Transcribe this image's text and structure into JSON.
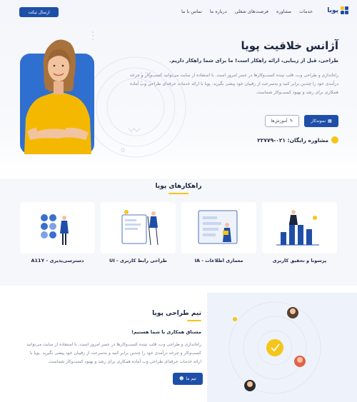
{
  "header": {
    "logo_text": "پویا",
    "nav": [
      "خدمات",
      "مشاوره",
      "فرصت‌های شغلی",
      "درباره ما",
      "تماس با ما"
    ],
    "ticket_label": "ارسال تیکت"
  },
  "hero": {
    "title": "آژانس خلاقیت پویا",
    "subtitle": "طراحی، قبل از زیبایی، ارائه راهکار است! ما برای شما راهکار داریم.",
    "description": "راه‌اندازی و طراحی وب، قلب تپنده کسب‌وکارها در عصر امروز است. با استفاده از سایت می‌توانید کسب‌وکار و چرخه درآمدی خود را چندین برابر کنید و به‌سرعت از رقیبان خود پیشی بگیرید. پویا با ارائه خدمات حرفه‌ای طراحی وب آماده همکاری برای رشد و بهبود کسب‌وکار شماست.",
    "sample_label": "نمونه‌کار",
    "learning_label": "آموزش‌ها",
    "consult_label": "مشاوره رایگان: ۰۲۱-۲۲۷۷۹"
  },
  "solutions": {
    "title": "راهکارهای پویا",
    "items": [
      {
        "label": "پرسونا و تحقیق کاربری",
        "icon": "persona-research-illustration"
      },
      {
        "label": "معماری اطلاعات - IA",
        "icon": "information-architecture-illustration"
      },
      {
        "label": "طراحی رابط کاربری - UI",
        "icon": "ui-design-illustration"
      },
      {
        "label": "دسترسی‌پذیری - A11Y",
        "icon": "accessibility-illustration"
      }
    ]
  },
  "team": {
    "title": "تیم طراحی پویا",
    "subtitle": "مشتاق همکاری با شما هستیم!",
    "description": "راه‌اندازی و طراحی وب، قلب تپنده کسب‌وکارها در عصر امروز است. با استفاده از سایت می‌توانید کسب‌وکار و چرخه درآمدی خود را چندین برابر کنید و به‌سرعت از رقیبان خود پیشی بگیرید. پویا با ارائه خدمات حرفه‌ای طراحی وب آماده همکاری برای رشد و بهبود کسب‌وکار شماست.",
    "button_label": "تیم ما"
  },
  "colors": {
    "primary": "#1e4fa8",
    "accent": "#f5c518",
    "hero_shirt": "#f5b800",
    "hero_bg_card": "#2f6fd0"
  }
}
